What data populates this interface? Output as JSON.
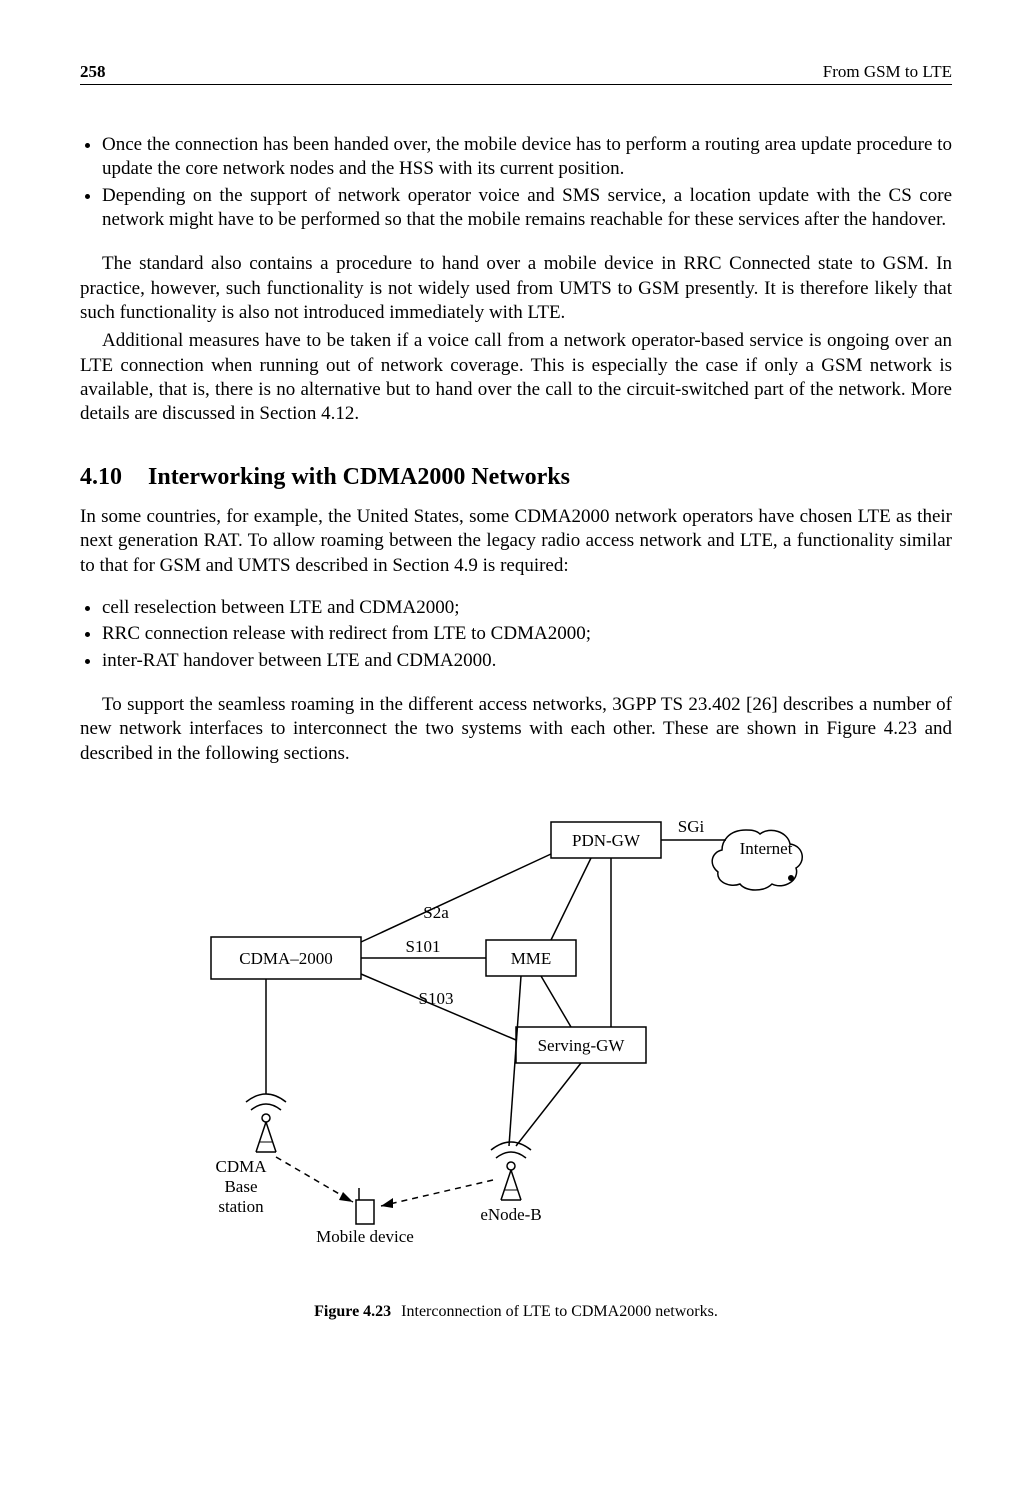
{
  "header": {
    "page_number": "258",
    "running_head": "From GSM to LTE"
  },
  "bullets_a": [
    "Once the connection has been handed over, the mobile device has to perform a routing area update procedure to update the core network nodes and the HSS with its current position.",
    "Depending on the support of network operator voice and SMS service, a location update with the CS core network might have to be performed so that the mobile remains reachable for these services after the handover."
  ],
  "paragraph_a": "The standard also contains a procedure to hand over a mobile device in RRC Connected state to GSM. In practice, however, such functionality is not widely used from UMTS to GSM presently. It is therefore likely that such functionality is also not introduced immediately with LTE.",
  "paragraph_b": "Additional measures have to be taken if a voice call from a network operator-based service is ongoing over an LTE connection when running out of network coverage. This is especially the case if only a GSM network is available, that is, there is no alternative but to hand over the call to the circuit-switched part of the network. More details are discussed in Section 4.12.",
  "section": {
    "number": "4.10",
    "title": "Interworking with CDMA2000 Networks"
  },
  "paragraph_c": "In some countries, for example, the United States, some CDMA2000 network operators have chosen LTE as their next generation RAT. To allow roaming between the legacy radio access network and LTE, a functionality similar to that for GSM and UMTS described in Section 4.9 is required:",
  "bullets_b": [
    "cell reselection between LTE and CDMA2000;",
    "RRC connection release with redirect from LTE to CDMA2000;",
    "inter-RAT handover between LTE and CDMA2000."
  ],
  "paragraph_d": "To support the seamless roaming in the different access networks, 3GPP TS 23.402 [26] describes a number of new network interfaces to interconnect the two systems with each other. These are shown in Figure 4.23 and described in the following sections.",
  "diagram": {
    "nodes": {
      "pdn_gw": "PDN-GW",
      "internet": "Internet",
      "cdma2000": "CDMA–2000",
      "mme": "MME",
      "serving_gw": "Serving-GW",
      "cdma_bs_l1": "CDMA",
      "cdma_bs_l2": "Base",
      "cdma_bs_l3": "station",
      "enodeb": "eNode-B",
      "mobile": "Mobile device"
    },
    "links": {
      "sgi": "SGi",
      "s2a": "S2a",
      "s101": "S101",
      "s103": "S103"
    }
  },
  "figure_caption": {
    "label": "Figure 4.23",
    "text": "Interconnection of LTE to CDMA2000 networks."
  }
}
